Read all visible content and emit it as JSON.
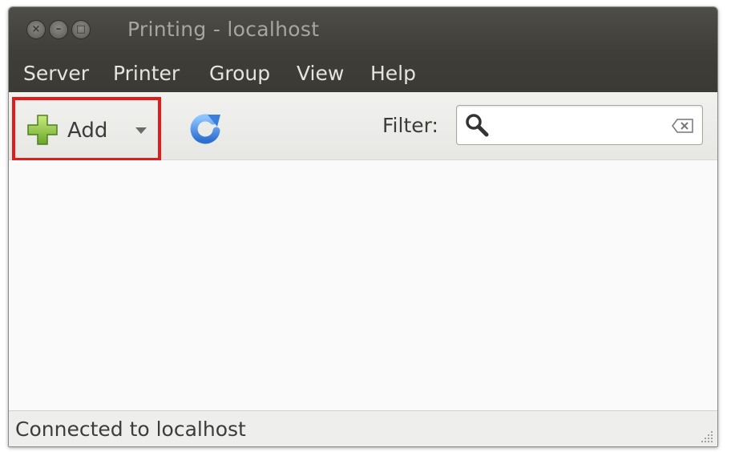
{
  "window": {
    "title": "Printing - localhost",
    "controls": {
      "close": "×",
      "minimize": "–",
      "maximize": "□"
    }
  },
  "menu": {
    "items": [
      "Server",
      "Printer",
      "Group",
      "View",
      "Help"
    ]
  },
  "toolbar": {
    "add_label": "Add",
    "add_icon": "plus-icon",
    "refresh_icon": "refresh-icon",
    "filter_label": "Filter:",
    "filter_value": "",
    "search_icon": "search-icon",
    "clear_icon": "clear-icon"
  },
  "status": {
    "text": "Connected to localhost"
  },
  "colors": {
    "titlebar": "#3f3d38",
    "highlight": "#e21b1b",
    "plus": "#8dc63f",
    "refresh": "#3d8ee6"
  }
}
